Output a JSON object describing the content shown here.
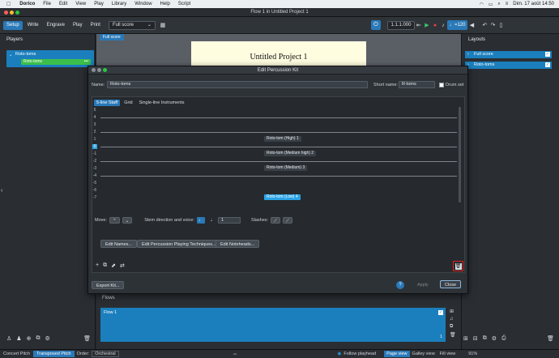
{
  "menubar": {
    "app": "Dorico",
    "items": [
      "File",
      "Edit",
      "View",
      "Play",
      "Library",
      "Window",
      "Help",
      "Script"
    ],
    "datetime": "Dim. 17 août  14:50"
  },
  "window": {
    "title": "Flow 1 in Untitled Project 1"
  },
  "toolbar": {
    "modes": [
      "Setup",
      "Write",
      "Engrave",
      "Play",
      "Print"
    ],
    "layout_select": "Full score",
    "position": "1.1.1.000",
    "tempo": "120"
  },
  "left_panel": {
    "title": "Players",
    "player_name": "Roto-toms",
    "instrument_name": "Roto-toms"
  },
  "score": {
    "tab": "Full score",
    "title": "Untitled Project 1"
  },
  "right_panel": {
    "title": "Layouts",
    "layouts": [
      "Full score",
      "Roto-toms"
    ]
  },
  "dialog": {
    "title": "Edit Percussion Kit",
    "name_label": "Name:",
    "name_value": "Roto-toms",
    "short_label": "Short name:",
    "short_value": "R-toms",
    "drumset_label": "Drum set",
    "tabs": [
      "5-line Staff",
      "Grid",
      "Single-line Instruments"
    ],
    "row_labels": [
      "5",
      "4",
      "3",
      "2",
      "1",
      "0",
      "-1",
      "-2",
      "-3",
      "-4",
      "-5",
      "-6",
      "-7"
    ],
    "instruments": [
      {
        "label": "Roto-tom (High) 1",
        "row": 4
      },
      {
        "label": "Roto-tom (Medium high) 2",
        "row": 6
      },
      {
        "label": "Roto-tom (Medium) 3",
        "row": 8
      },
      {
        "label": "Roto-tom (Low) 4",
        "row": 12
      }
    ],
    "move_label": "Move:",
    "stem_label": "Stem direction and voice:",
    "voice_value": "1",
    "slashes_label": "Slashes:",
    "buttons": {
      "edit_names": "Edit Names...",
      "edit_techniques": "Edit Percussion Playing Techniques...",
      "edit_noteheads": "Edit Noteheads...",
      "export": "Export Kit...",
      "help": "?",
      "apply": "Apply",
      "close": "Close"
    },
    "colors": {
      "highlight_delete": "#e02020",
      "selected": "#2ba3e6"
    }
  },
  "flows": {
    "title": "Flows",
    "flow_name": "Flow 1",
    "flow_number": "1"
  },
  "statusbar": {
    "concert_pitch": "Concert Pitch",
    "transposed_pitch": "Transposed Pitch",
    "order_label": "Order:",
    "order_value": "Orchestral",
    "follow_playhead": "Follow playhead",
    "page_view": "Page view",
    "galley_view": "Galley view",
    "fill_view": "Fill view",
    "zoom": "91%"
  }
}
